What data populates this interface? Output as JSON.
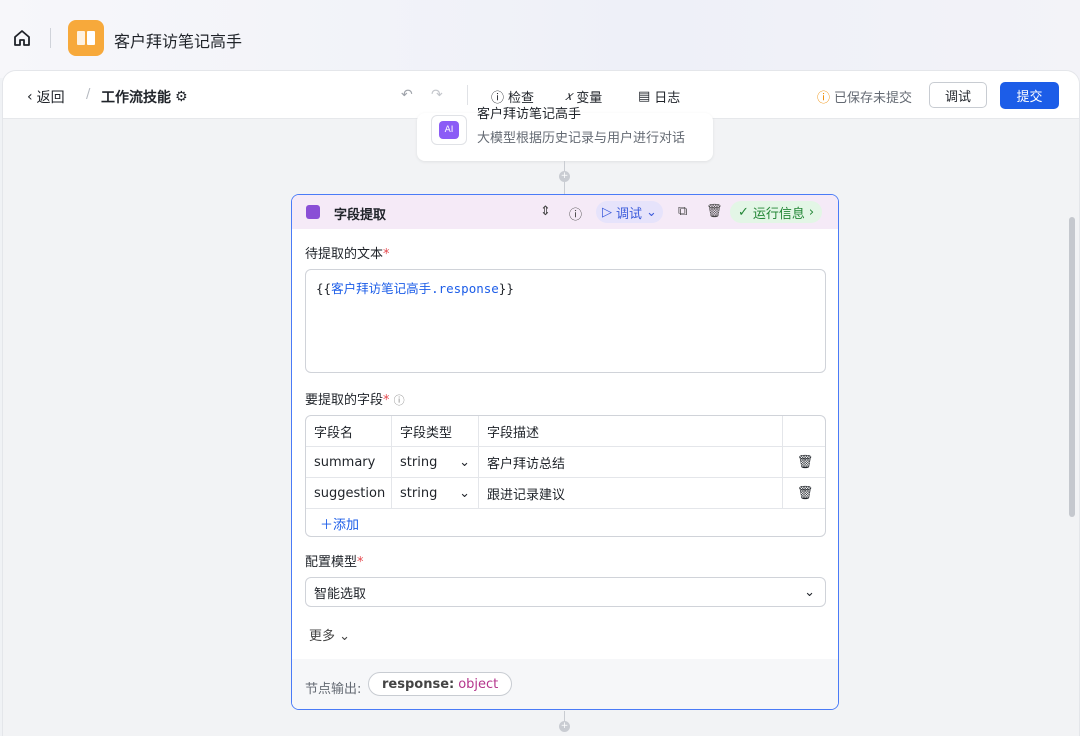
{
  "app": {
    "title": "客户拜访笔记高手"
  },
  "toolbar": {
    "back": "返回",
    "crumb_sep": "/",
    "breadcrumb": "工作流技能",
    "check": "检查",
    "variables": "变量",
    "log": "日志",
    "save_status": "已保存未提交",
    "debug_button": "调试",
    "submit_button": "提交"
  },
  "prev_node": {
    "title": "客户拜访笔记高手",
    "description": "大模型根据历史记录与用户进行对话",
    "icon_text": "AI"
  },
  "node": {
    "title": "字段提取",
    "debug_chip": "调试",
    "run_info": "运行信息",
    "text_label": "待提取的文本",
    "text_value_prefix": "{{",
    "text_value_ref": "客户拜访笔记高手.response",
    "text_value_suffix": "}}",
    "fields_label": "要提取的字段",
    "columns": [
      "字段名",
      "字段类型",
      "字段描述"
    ],
    "rows": [
      {
        "name": "summary",
        "type": "string",
        "desc": "客户拜访总结"
      },
      {
        "name": "suggestion",
        "type": "string",
        "desc": "跟进记录建议"
      }
    ],
    "add_label": "添加",
    "model_label": "配置模型",
    "model_value": "智能选取",
    "more": "更多",
    "output_label": "节点输出:",
    "output_key": "response:",
    "output_type": "object"
  },
  "colors": {
    "accent": "#1c5de8",
    "node_border": "#4a7bf7",
    "app_icon": "#f7a93b"
  },
  "icons": [
    "home-icon",
    "app-book-icon",
    "settings-icon",
    "undo-icon",
    "redo-icon",
    "check-icon",
    "variable-icon",
    "log-icon",
    "warning-icon",
    "field-extract-icon",
    "collapse-icon",
    "help-icon",
    "play-icon",
    "copy-icon",
    "trash-icon",
    "check-mark-icon",
    "info-icon",
    "chevron-down-icon"
  ]
}
